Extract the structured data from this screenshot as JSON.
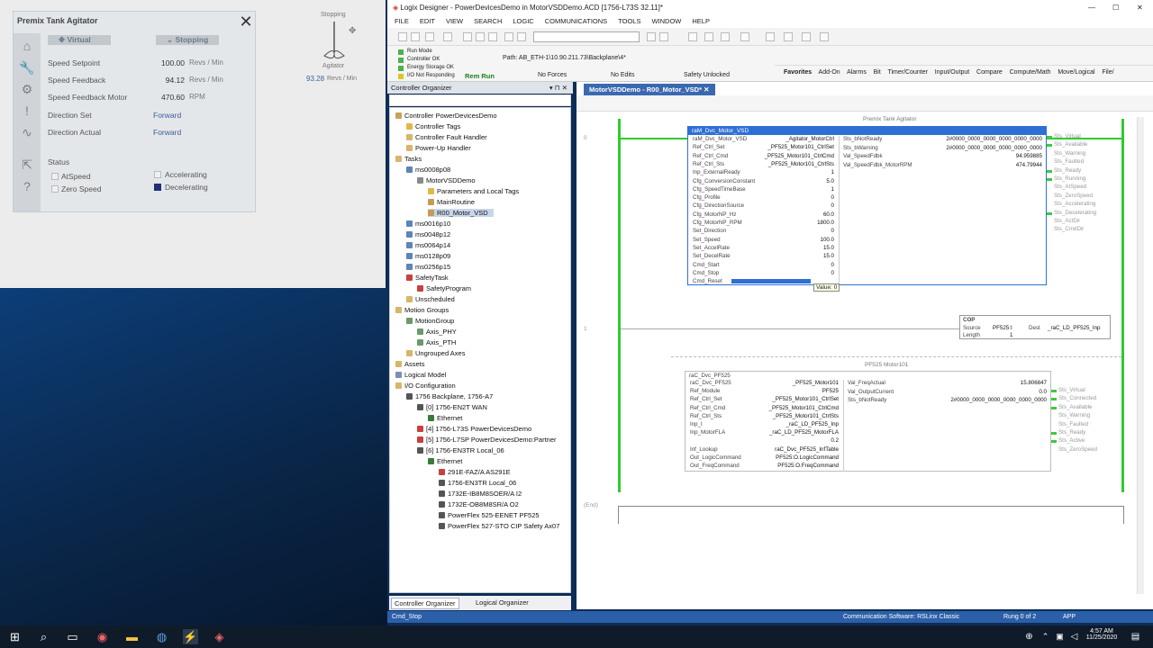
{
  "hmi": {
    "title": "Premix Tank Agitator",
    "tabs": [
      {
        "label": "Virtual"
      },
      {
        "label": "Stopping"
      }
    ],
    "params": [
      {
        "label": "Speed Setpoint",
        "value": "100.00",
        "unit": "Revs   / Min"
      },
      {
        "label": "Speed Feedback",
        "value": "94.12",
        "unit": "Revs   / Min"
      },
      {
        "label": "Speed Feedback Motor",
        "value": "470.60",
        "unit": "RPM"
      }
    ],
    "direction_set": {
      "label": "Direction Set",
      "value": "Forward"
    },
    "direction_actual": {
      "label": "Direction Actual",
      "value": "Forward"
    },
    "status_label": "Status",
    "status_items": [
      {
        "label": "AtSpeed"
      },
      {
        "label": "Zero Speed"
      },
      {
        "label": "Accelerating"
      },
      {
        "label": "Decelerating"
      }
    ],
    "agitator": {
      "state": "Stopping",
      "name": "Agitator",
      "value": "93.28",
      "unit": "Revs   / Min"
    }
  },
  "app": {
    "title": "Logix Designer - PowerDevicesDemo in MotorVSDDemo.ACD [1756-L73S 32.11]*",
    "menu": [
      "FILE",
      "EDIT",
      "VIEW",
      "SEARCH",
      "LOGIC",
      "COMMUNICATIONS",
      "TOOLS",
      "WINDOW",
      "HELP"
    ],
    "status_lines": [
      "Run Mode",
      "Controller OK",
      "Energy Storage OK",
      "I/O Not Responding"
    ],
    "mode": "Rem Run",
    "path": "Path:  AB_ETH-1\\10.90.211.73\\Backplane\\4*",
    "no_forces": "No Forces",
    "no_edits": "No Edits",
    "safety": "Safety Unlocked",
    "instr_tabs": [
      "Favorites",
      "Add-On",
      "Alarms",
      "Bit",
      "Timer/Counter",
      "Input/Output",
      "Compare",
      "Compute/Math",
      "Move/Logical",
      "File/"
    ]
  },
  "organizer": {
    "title": "Controller Organizer",
    "items": [
      {
        "label": "Controller PowerDevicesDemo",
        "level": 0,
        "color": "#c8a15a"
      },
      {
        "label": "Controller Tags",
        "level": 1,
        "color": "#e0b84a"
      },
      {
        "label": "Controller Fault Handler",
        "level": 1,
        "color": "#d9b46b"
      },
      {
        "label": "Power-Up Handler",
        "level": 1,
        "color": "#d9b46b"
      },
      {
        "label": "Tasks",
        "level": 0,
        "color": "#d9b46b"
      },
      {
        "label": "ms0008p08",
        "level": 1,
        "color": "#5a86b8"
      },
      {
        "label": "MotorVSDDemo",
        "level": 2,
        "color": "#8a8a8a"
      },
      {
        "label": "Parameters and Local Tags",
        "level": 3,
        "color": "#e0b84a"
      },
      {
        "label": "MainRoutine",
        "level": 3,
        "color": "#c79b55"
      },
      {
        "label": "R00_Motor_VSD",
        "level": 3,
        "color": "#c79b55"
      },
      {
        "label": "ms0016p10",
        "level": 1,
        "color": "#5a86b8"
      },
      {
        "label": "ms0048p12",
        "level": 1,
        "color": "#5a86b8"
      },
      {
        "label": "ms0064p14",
        "level": 1,
        "color": "#5a86b8"
      },
      {
        "label": "ms0128p09",
        "level": 1,
        "color": "#5a86b8"
      },
      {
        "label": "ms0256p15",
        "level": 1,
        "color": "#5a86b8"
      },
      {
        "label": "SafetyTask",
        "level": 1,
        "color": "#c84040"
      },
      {
        "label": "SafetyProgram",
        "level": 2,
        "color": "#c84040"
      },
      {
        "label": "Unscheduled",
        "level": 1,
        "color": "#d9b46b"
      },
      {
        "label": "Motion Groups",
        "level": 0,
        "color": "#d9b46b"
      },
      {
        "label": "MotionGroup",
        "level": 1,
        "color": "#6a9a6a"
      },
      {
        "label": "Axis_PHY",
        "level": 2,
        "color": "#6a9a6a"
      },
      {
        "label": "Axis_PTH",
        "level": 2,
        "color": "#6a9a6a"
      },
      {
        "label": "Ungrouped Axes",
        "level": 1,
        "color": "#d9b46b"
      },
      {
        "label": "Assets",
        "level": 0,
        "color": "#d9b46b"
      },
      {
        "label": "Logical Model",
        "level": 0,
        "color": "#7c8fb0"
      },
      {
        "label": "I/O Configuration",
        "level": 0,
        "color": "#d9b46b"
      },
      {
        "label": "1756 Backplane, 1756-A7",
        "level": 1,
        "color": "#555"
      },
      {
        "label": "[0] 1756-EN2T WAN",
        "level": 2,
        "color": "#555"
      },
      {
        "label": "Ethernet",
        "level": 3,
        "color": "#3a7a3a"
      },
      {
        "label": "[4] 1756-L73S PowerDevicesDemo",
        "level": 2,
        "color": "#c84040"
      },
      {
        "label": "[5] 1756-L7SP PowerDevicesDemo:Partner",
        "level": 2,
        "color": "#c84040"
      },
      {
        "label": "[6] 1756-EN3TR Local_06",
        "level": 2,
        "color": "#555"
      },
      {
        "label": "Ethernet",
        "level": 3,
        "color": "#3a7a3a"
      },
      {
        "label": "291E-FAZ/A AS291E",
        "level": 4,
        "color": "#c84040"
      },
      {
        "label": "1756-EN3TR Local_06",
        "level": 4,
        "color": "#555"
      },
      {
        "label": "1732E-IB8M8SOER/A I2",
        "level": 4,
        "color": "#555"
      },
      {
        "label": "1732E-OB8M8SR/A O2",
        "level": 4,
        "color": "#555"
      },
      {
        "label": "PowerFlex 525-EENET PF525",
        "level": 4,
        "color": "#555"
      },
      {
        "label": "PowerFlex 527-STO CIP Safety Ax07",
        "level": 4,
        "color": "#555"
      }
    ],
    "tabs": [
      {
        "label": "Controller Organizer"
      },
      {
        "label": "Logical Organizer"
      }
    ]
  },
  "editor": {
    "tab": "MotorVSDDemo - R00_Motor_VSD*",
    "rung0_label": "Premix Tank Agitator",
    "rung0_num": "0",
    "rung1_num": "1",
    "end": "(End)",
    "aoi1": {
      "name": "raM_Dvc_Motor_VSD",
      "inputs": [
        {
          "pin": "raM_Dvc_Motor_VSD",
          "val": "_Agitator_MotorCtrl"
        },
        {
          "pin": "Ref_Ctrl_Set",
          "val": "_PF525_Motor101_CtrlSet"
        },
        {
          "pin": "Ref_Ctrl_Cmd",
          "val": "_PF525_Motor101_CtrlCmd"
        },
        {
          "pin": "Ref_Ctrl_Sts",
          "val": "_PF525_Motor101_CtrlSts"
        },
        {
          "pin": "Inp_ExternalReady",
          "val": "1"
        },
        {
          "pin": "Cfg_ConversionConstant",
          "val": "5.0"
        },
        {
          "pin": "Cfg_SpeedTimeBase",
          "val": "1"
        },
        {
          "pin": "Cfg_Profile",
          "val": "0"
        },
        {
          "pin": "Cfg_DirectionSource",
          "val": "0"
        },
        {
          "pin": "Cfg_MotorNP_Hz",
          "val": "60.0"
        },
        {
          "pin": "Cfg_MotorNP_RPM",
          "val": "1800.0"
        },
        {
          "pin": "Set_Direction",
          "val": "0"
        },
        {
          "pin": "Set_Speed",
          "val": "100.0"
        },
        {
          "pin": "Set_AccelRate",
          "val": "15.0"
        },
        {
          "pin": "Set_DecelRate",
          "val": "15.0"
        },
        {
          "pin": "Cmd_Start",
          "val": "0"
        },
        {
          "pin": "Cmd_Stop",
          "val": "0"
        },
        {
          "pin": "Cmd_Reset",
          "val": ""
        }
      ],
      "outputs": [
        {
          "pin": "Sts_bNotReady",
          "val": "2#0000_0000_0000_0000_0000_0000"
        },
        {
          "pin": "Sts_bWarning",
          "val": "2#0000_0000_0000_0000_0000_0000"
        },
        {
          "pin": "Val_SpeedFdbk",
          "val": "94.959885"
        },
        {
          "pin": "Val_SpeedFdbk_MotorRPM",
          "val": "474.79944"
        }
      ],
      "bits": [
        {
          "label": "Sts_Virtual",
          "on": true
        },
        {
          "label": "Sts_Available",
          "on": true
        },
        {
          "label": "Sts_Warning",
          "on": false
        },
        {
          "label": "Sts_Faulted",
          "on": false
        },
        {
          "label": "Sts_Ready",
          "on": true
        },
        {
          "label": "Sts_Running",
          "on": true
        },
        {
          "label": "Sts_AtSpeed",
          "on": false
        },
        {
          "label": "Sts_ZeroSpeed",
          "on": false
        },
        {
          "label": "Sts_Accelerating",
          "on": false
        },
        {
          "label": "Sts_Decelerating",
          "on": true
        },
        {
          "label": "Sts_ActDir",
          "on": false
        },
        {
          "label": "Sts_CmdDir",
          "on": false
        }
      ]
    },
    "tooltip": "Value: 0",
    "cop": {
      "name": "COP",
      "source_label": "Source",
      "source": "PF525:I",
      "length_label": "Length",
      "length": "1",
      "dest_label": "Dest",
      "dest": "_raC_LD_PF525_Inp"
    },
    "aoi2_label": "PF525 Motor101",
    "aoi2": {
      "name": "raC_Dvc_PF525",
      "inputs": [
        {
          "pin": "raC_Dvc_PF525",
          "val": "_PF525_Motor101"
        },
        {
          "pin": "Ref_Module",
          "val": "PF525"
        },
        {
          "pin": "Ref_Ctrl_Set",
          "val": "_PF525_Motor101_CtrlSet"
        },
        {
          "pin": "Ref_Ctrl_Cmd",
          "val": "_PF525_Motor101_CtrlCmd"
        },
        {
          "pin": "Ref_Ctrl_Sts",
          "val": "_PF525_Motor101_CtrlSts"
        },
        {
          "pin": "Inp_I",
          "val": "_raC_LD_PF525_Inp"
        },
        {
          "pin": "Inp_MotorFLA",
          "val": "_raC_LD_PF525_MotorFLA"
        },
        {
          "pin": "",
          "val": "0.2"
        },
        {
          "pin": "Inf_Lookup",
          "val": "raC_Dvc_PF525_InfTable"
        },
        {
          "pin": "Out_LogicCommand",
          "val": "PF525:O.LogicCommand"
        },
        {
          "pin": "Out_FreqCommand",
          "val": "PF525:O.FreqCommand"
        }
      ],
      "outputs": [
        {
          "pin": "Val_FreqActual",
          "val": "15.806847"
        },
        {
          "pin": "Val_OutputCurrent",
          "val": "0.0"
        },
        {
          "pin": "Sts_bNotReady",
          "val": "2#0000_0000_0000_0000_0000_0000"
        }
      ],
      "bits": [
        {
          "label": "Sts_Virtual",
          "on": true
        },
        {
          "label": "Sts_Connected",
          "on": true
        },
        {
          "label": "Sts_Available",
          "on": true
        },
        {
          "label": "Sts_Warning",
          "on": false
        },
        {
          "label": "Sts_Faulted",
          "on": false
        },
        {
          "label": "Sts_Ready",
          "on": true
        },
        {
          "label": "Sts_Active",
          "on": true
        },
        {
          "label": "Sts_ZeroSpeed",
          "on": false
        }
      ]
    }
  },
  "statusbar": {
    "left": "Cmd_Stop",
    "comm": "Communication Software: RSLinx Classic",
    "rung": "Rung 0 of 2",
    "app": "APP"
  },
  "taskbar": {
    "time": "4:57 AM",
    "date": "11/25/2020"
  }
}
